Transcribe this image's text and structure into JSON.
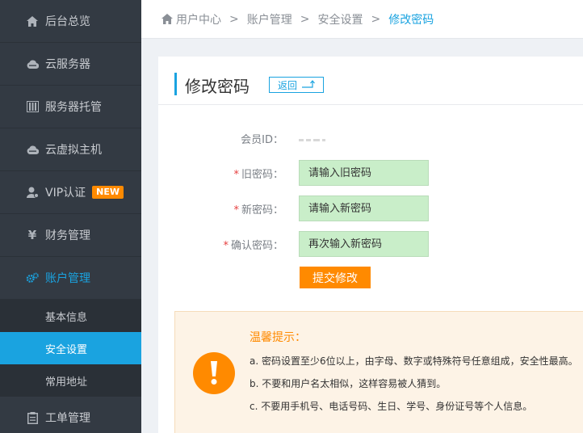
{
  "sidebar": {
    "items": [
      {
        "label": "后台总览",
        "icon": "home-icon"
      },
      {
        "label": "云服务器",
        "icon": "cloud-icon"
      },
      {
        "label": "服务器托管",
        "icon": "server-icon"
      },
      {
        "label": "云虚拟主机",
        "icon": "cloud-icon"
      },
      {
        "label": "VIP认证",
        "icon": "user-icon",
        "badge": "NEW"
      },
      {
        "label": "财务管理",
        "icon": "yen-icon"
      },
      {
        "label": "账户管理",
        "icon": "gear-icon",
        "active": true
      }
    ],
    "sub_items": [
      {
        "label": "基本信息"
      },
      {
        "label": "安全设置",
        "active": true
      },
      {
        "label": "常用地址"
      }
    ],
    "bottom_item": {
      "label": "工单管理",
      "icon": "ticket-icon"
    }
  },
  "breadcrumb": [
    "用户中心",
    "账户管理",
    "安全设置",
    "修改密码"
  ],
  "card": {
    "title": "修改密码",
    "back_label": "返回"
  },
  "form": {
    "member_id_label": "会员ID：",
    "old_password": {
      "label": "旧密码：",
      "placeholder": "请输入旧密码"
    },
    "new_password": {
      "label": "新密码：",
      "placeholder": "请输入新密码"
    },
    "confirm_password": {
      "label": "确认密码：",
      "placeholder": "再次输入新密码"
    },
    "required_mark": "*",
    "submit_label": "提交修改"
  },
  "tips": {
    "title": "温馨提示：",
    "lines": [
      "a. 密码设置至少6位以上，由字母、数字或特殊符号任意组成，安全性最高。",
      "b. 不要和用户名太相似，这样容易被人猜到。",
      "c. 不要用手机号、电话号码、生日、学号、身份证号等个人信息。"
    ]
  },
  "colors": {
    "accent": "#1aa3e0",
    "orange": "#ff8a00",
    "sidebar_bg": "#333a43",
    "input_bg": "#c9eec9"
  }
}
